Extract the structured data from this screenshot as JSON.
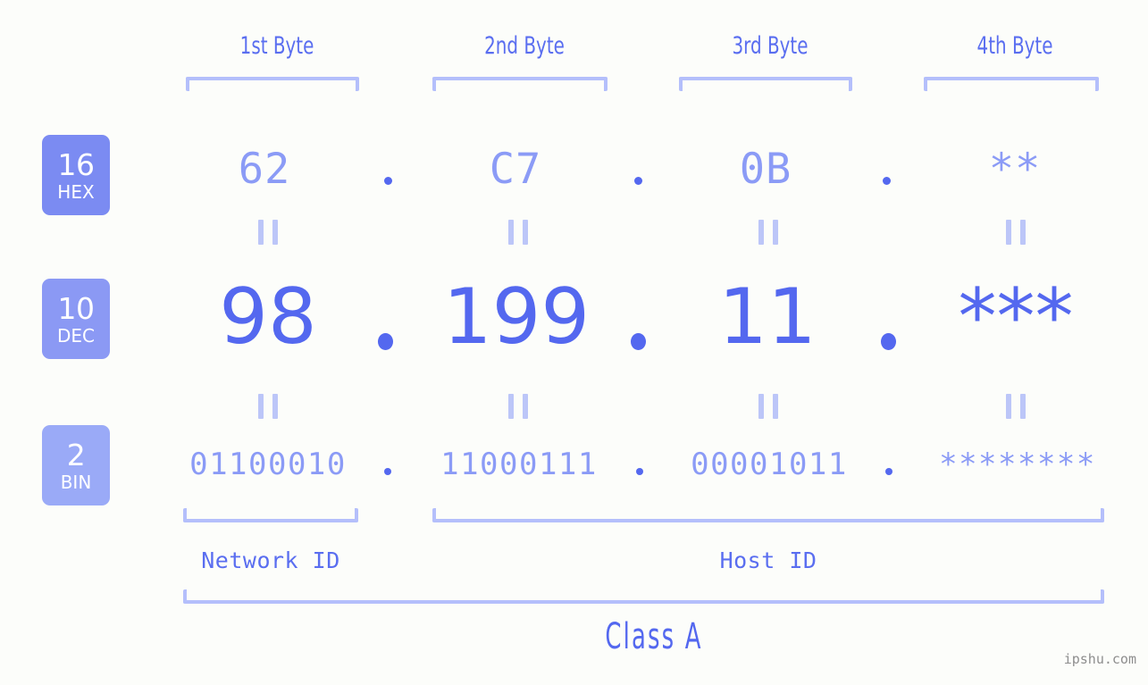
{
  "page": {
    "background_color": "#fcfdfa",
    "accent_color": "#5468ef",
    "accent_light_color": "#8b9bf6",
    "bracket_color": "#b4bffb",
    "watermark": "ipshu.com"
  },
  "byte_headers": [
    {
      "label": "1st Byte"
    },
    {
      "label": "2nd Byte"
    },
    {
      "label": "3rd Byte"
    },
    {
      "label": "4th Byte"
    }
  ],
  "bases": [
    {
      "num": "16",
      "name": "HEX",
      "color": "#7b8bf2"
    },
    {
      "num": "10",
      "name": "DEC",
      "color": "#8b99f4"
    },
    {
      "num": "2",
      "name": "BIN",
      "color": "#9aaaf7"
    }
  ],
  "rows": {
    "hex": {
      "values": [
        "62",
        "C7",
        "0B",
        "**"
      ],
      "separator": "."
    },
    "dec": {
      "values": [
        "98",
        "199",
        "11",
        "***"
      ],
      "separator": "."
    },
    "bin": {
      "values": [
        "01100010",
        "11000111",
        "00001011",
        "********"
      ],
      "separator": "."
    }
  },
  "equals_marks": {
    "glyph": "||",
    "count_per_row": 4
  },
  "id_labels": [
    {
      "label": "Network ID"
    },
    {
      "label": "Host ID"
    }
  ],
  "class": {
    "label": "Class A"
  }
}
